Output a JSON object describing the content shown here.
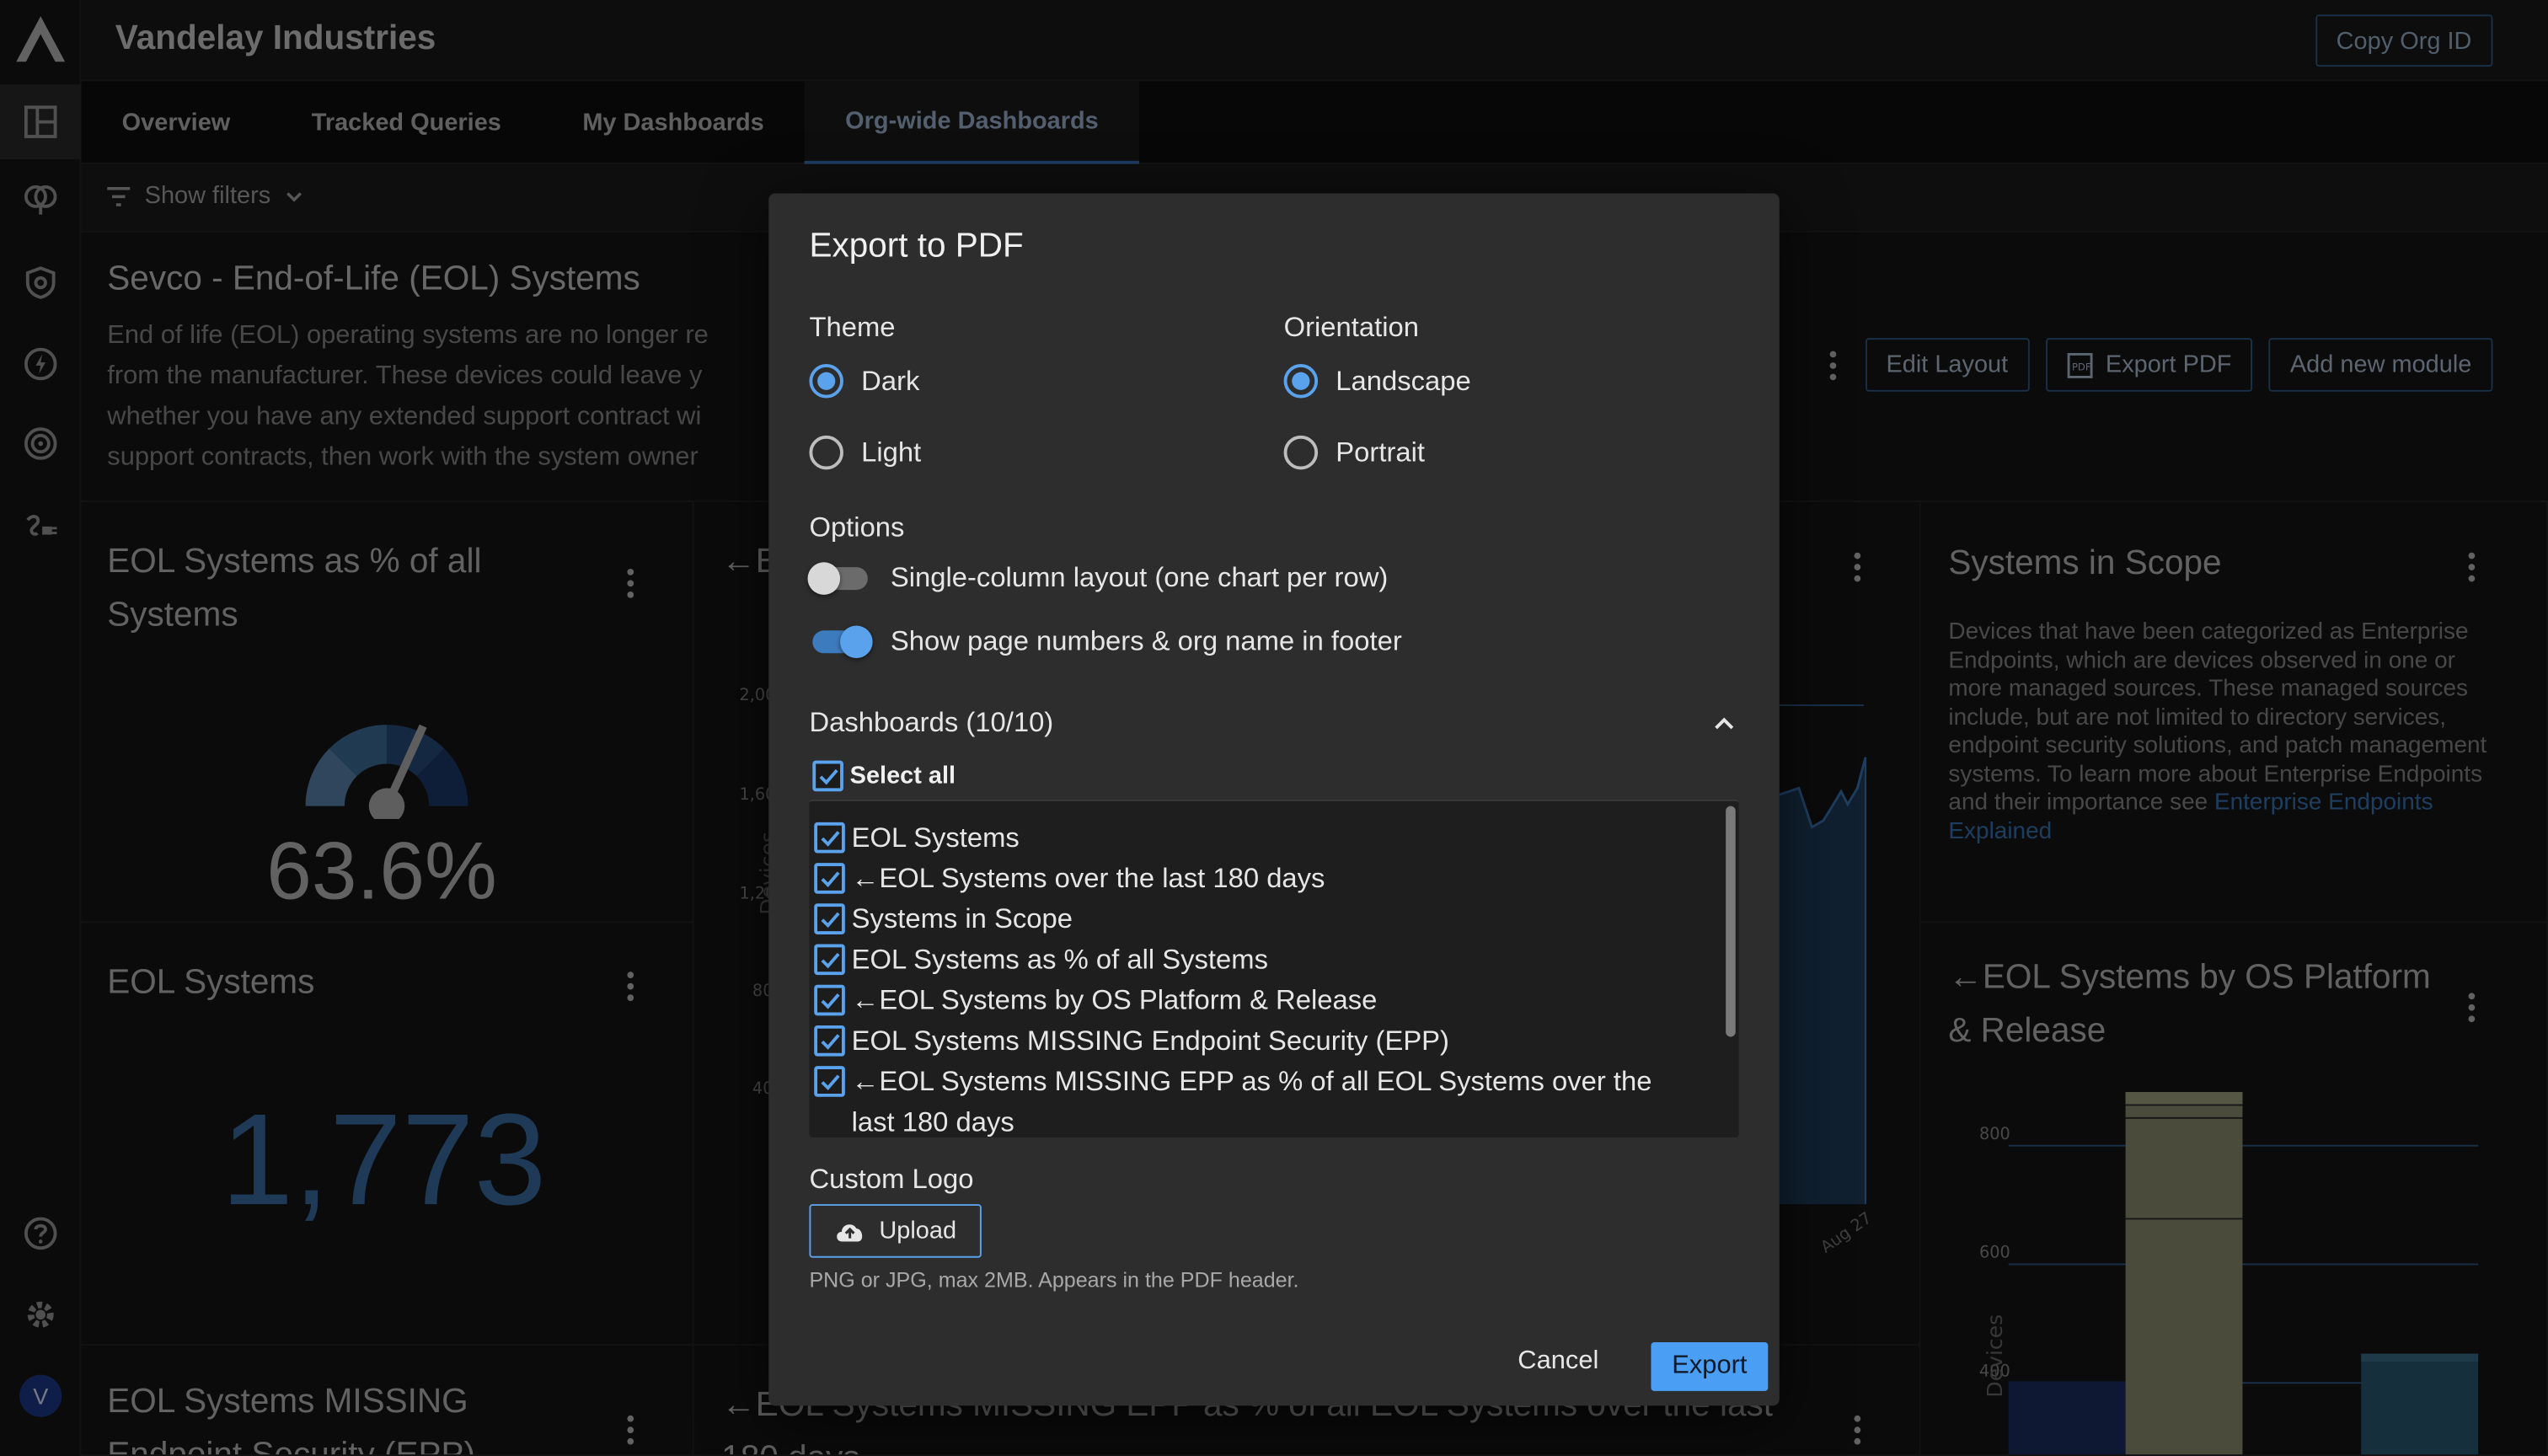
{
  "org": {
    "title": "Vandelay Industries",
    "copy_label": "Copy Org ID",
    "avatar_initial": "V"
  },
  "tabs": [
    {
      "label": "Overview"
    },
    {
      "label": "Tracked Queries"
    },
    {
      "label": "My Dashboards"
    },
    {
      "label": "Org-wide Dashboards",
      "active": true
    }
  ],
  "filters": {
    "label": "Show filters"
  },
  "dashboard": {
    "title": "Sevco - End-of-Life (EOL) Systems",
    "description_lines": [
      "End of life (EOL) operating systems are no longer re",
      "from the manufacturer. These devices could leave y",
      "whether you have any extended support contract wi",
      "support contracts, then work with the system owner"
    ],
    "actions": {
      "edit": "Edit Layout",
      "export": "Export PDF",
      "add": "Add new module"
    }
  },
  "cards": {
    "eol_pct": {
      "title": "EOL Systems as % of all Systems",
      "value": "63.6%",
      "gauge_fraction": 0.636
    },
    "eol_count": {
      "title": "EOL Systems",
      "value": "1,773"
    },
    "eol_missing": {
      "title": "EOL Systems MISSING Endpoint Security (EPP)"
    },
    "eol_over_time": {
      "title": "←E",
      "ylabel": "Devices",
      "yticks": [
        "2,00",
        "1,60",
        "1,20",
        "80",
        "40"
      ],
      "xtick": "Aug 27"
    },
    "eol_missing_pct": {
      "title": "←EOL Systems MISSING EPP as % of all EOL Systems over the last 180 days"
    },
    "scope": {
      "title": "Systems in Scope",
      "body": "Devices that have been categorized as Enterprise Endpoints, which are devices observed in one or more managed sources. These managed sources include, but are not limited to directory services, endpoint security solutions, and patch management systems. To learn more about Enterprise Endpoints and their importance see",
      "link": "Enterprise Endpoints Explained"
    },
    "by_os": {
      "title": "←EOL Systems by OS Platform & Release",
      "ylabel": "Devices",
      "yticks": [
        "800",
        "600",
        "400"
      ]
    }
  },
  "modal": {
    "title": "Export to PDF",
    "theme_label": "Theme",
    "theme_options": [
      {
        "label": "Dark",
        "selected": true
      },
      {
        "label": "Light",
        "selected": false
      }
    ],
    "orientation_label": "Orientation",
    "orientation_options": [
      {
        "label": "Landscape",
        "selected": true
      },
      {
        "label": "Portrait",
        "selected": false
      }
    ],
    "options_label": "Options",
    "toggles": [
      {
        "label": "Single-column layout (one chart per row)",
        "on": false
      },
      {
        "label": "Show page numbers & org name in footer",
        "on": true
      }
    ],
    "dashboards_label": "Dashboards (10/10)",
    "select_all": "Select all",
    "items": [
      "EOL Systems",
      "←EOL Systems over the last 180 days",
      "Systems in Scope",
      "EOL Systems as % of all Systems",
      "←EOL Systems by OS Platform & Release",
      "EOL Systems MISSING Endpoint Security (EPP)",
      "←EOL Systems MISSING EPP as % of all EOL Systems over the last 180 days"
    ],
    "custom_logo_label": "Custom Logo",
    "upload_label": "Upload",
    "hint": "PNG or JPG, max 2MB. Appears in the PDF header.",
    "cancel": "Cancel",
    "export": "Export"
  },
  "colors": {
    "accent": "#5aa2ec",
    "primary_button": "#4a9ff5",
    "chart_blue": "#3a6fa6"
  }
}
